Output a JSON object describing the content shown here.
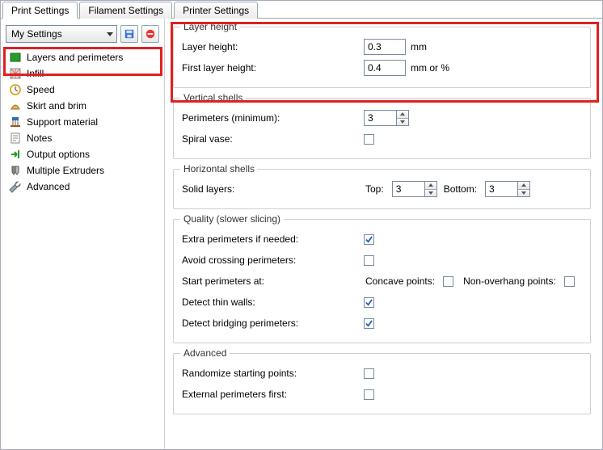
{
  "tabs": {
    "print": "Print Settings",
    "filament": "Filament Settings",
    "printer": "Printer Settings"
  },
  "preset": {
    "selected": "My Settings"
  },
  "sidebar": {
    "items": [
      {
        "label": "Layers and perimeters"
      },
      {
        "label": "Infill"
      },
      {
        "label": "Speed"
      },
      {
        "label": "Skirt and brim"
      },
      {
        "label": "Support material"
      },
      {
        "label": "Notes"
      },
      {
        "label": "Output options"
      },
      {
        "label": "Multiple Extruders"
      },
      {
        "label": "Advanced"
      }
    ]
  },
  "groups": {
    "layer_height": {
      "title": "Layer height",
      "layer_height_label": "Layer height:",
      "layer_height_value": "0.3",
      "layer_height_unit": "mm",
      "first_layer_label": "First layer height:",
      "first_layer_value": "0.4",
      "first_layer_unit": "mm or %"
    },
    "vertical_shells": {
      "title": "Vertical shells",
      "perimeters_label": "Perimeters (minimum):",
      "perimeters_value": "3",
      "spiral_vase_label": "Spiral vase:",
      "spiral_vase_checked": false
    },
    "horizontal_shells": {
      "title": "Horizontal shells",
      "solid_layers_label": "Solid layers:",
      "top_label": "Top:",
      "top_value": "3",
      "bottom_label": "Bottom:",
      "bottom_value": "3"
    },
    "quality": {
      "title": "Quality (slower slicing)",
      "extra_perimeters_label": "Extra perimeters if needed:",
      "extra_perimeters_checked": true,
      "avoid_crossing_label": "Avoid crossing perimeters:",
      "avoid_crossing_checked": false,
      "start_perimeters_label": "Start perimeters at:",
      "concave_label": "Concave points:",
      "concave_checked": false,
      "nonoverhang_label": "Non-overhang points:",
      "nonoverhang_checked": false,
      "thin_walls_label": "Detect thin walls:",
      "thin_walls_checked": true,
      "bridging_label": "Detect bridging perimeters:",
      "bridging_checked": true
    },
    "advanced": {
      "title": "Advanced",
      "randomize_label": "Randomize starting points:",
      "randomize_checked": false,
      "external_first_label": "External perimeters first:",
      "external_first_checked": false
    }
  }
}
